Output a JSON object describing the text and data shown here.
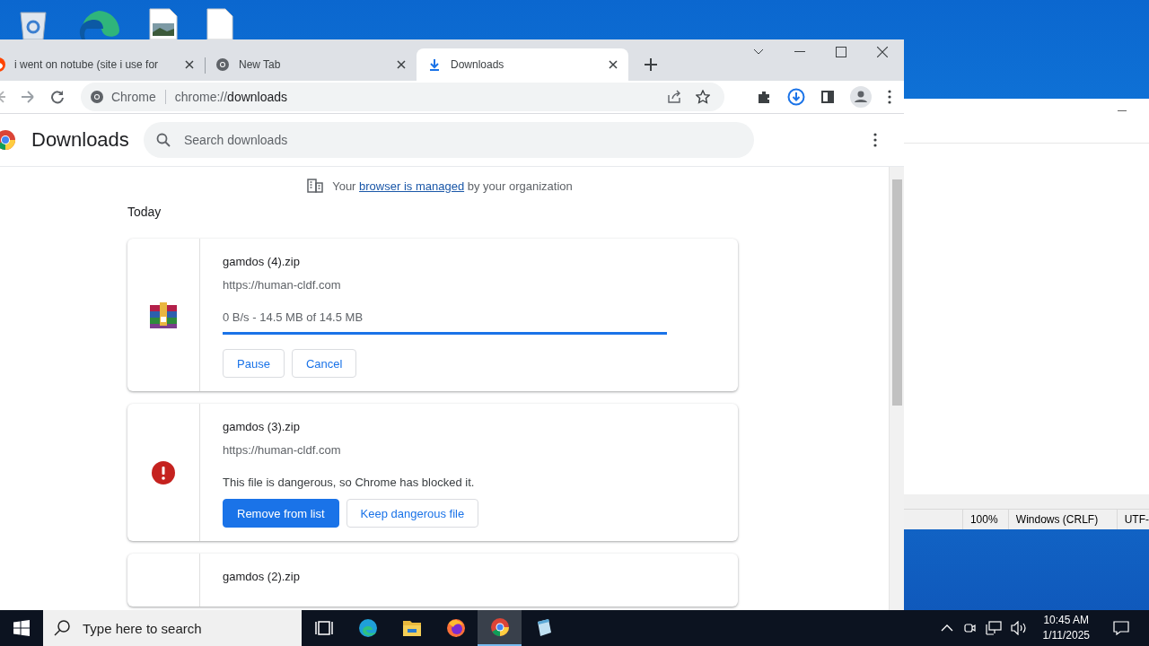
{
  "browser": {
    "tabs": [
      {
        "kind": "reddit",
        "title": "i went on notube (site i use for",
        "selected": false
      },
      {
        "kind": "chrome",
        "title": "New Tab",
        "selected": false
      },
      {
        "kind": "download",
        "title": "Downloads",
        "selected": true
      }
    ],
    "address_bar": {
      "site_label": "Chrome",
      "url_prefix": "chrome://",
      "url_host": "downloads"
    },
    "page": {
      "title": "Downloads",
      "search": {
        "placeholder": "Search downloads"
      },
      "managed_notice": {
        "before": "Your",
        "link": "browser is managed",
        "after": "by your organization"
      },
      "section": "Today",
      "downloads": [
        {
          "kind": "in_progress",
          "name": "gamdos (4).zip",
          "source": "https://human-cldf.com",
          "status": "0 B/s - 14.5 MB of 14.5 MB",
          "level": 1,
          "buttons": [
            {
              "label": "Pause",
              "primary": false
            },
            {
              "label": "Cancel",
              "primary": false
            }
          ]
        },
        {
          "kind": "dangerous",
          "name": "gamdos (3).zip",
          "source": "https://human-cldf.com",
          "warning": "This file is dangerous, so Chrome has blocked it.",
          "buttons": [
            {
              "label": "Remove from list",
              "primary": true
            },
            {
              "label": "Keep dangerous file",
              "primary": false
            }
          ]
        },
        {
          "kind": "partial",
          "name": "gamdos (2).zip"
        }
      ]
    }
  },
  "notepad": {
    "status_bar": [
      "100%",
      "Windows (CRLF)",
      "UTF-"
    ]
  },
  "taskbar": {
    "search": {
      "placeholder": "Type here to search"
    },
    "apps": [
      {
        "kind": "task-view",
        "selected": false
      },
      {
        "kind": "edge",
        "selected": false
      },
      {
        "kind": "explorer",
        "selected": false
      },
      {
        "kind": "firefox",
        "selected": false
      },
      {
        "kind": "chrome",
        "selected": true
      },
      {
        "kind": "notepad",
        "selected": false
      }
    ],
    "clock": {
      "time": "10:45 AM",
      "date": "1/11/2025"
    }
  }
}
